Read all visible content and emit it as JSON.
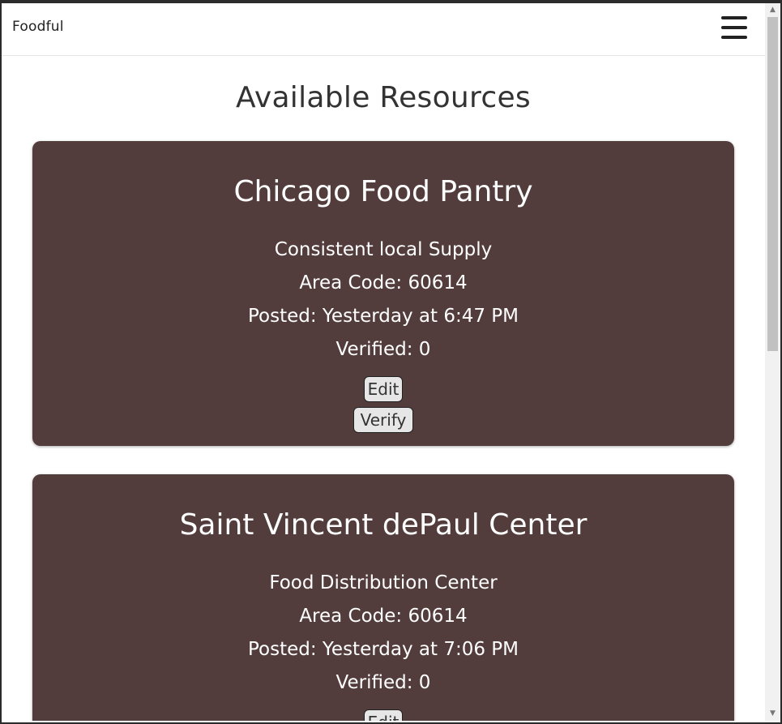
{
  "navbar": {
    "brand": "Foodful",
    "menu_icon": "hamburger-menu-icon"
  },
  "page": {
    "title": "Available Resources"
  },
  "resources": [
    {
      "name": "Chicago Food Pantry",
      "description": "Consistent local Supply",
      "area_code": "Area Code: 60614",
      "posted": "Posted: Yesterday at 6:47 PM",
      "verified": "Verified: 0",
      "edit_label": "Edit",
      "verify_label": "Verify"
    },
    {
      "name": "Saint Vincent dePaul Center",
      "description": "Food Distribution Center",
      "area_code": "Area Code: 60614",
      "posted": "Posted: Yesterday at 7:06 PM",
      "verified": "Verified: 0",
      "edit_label": "Edit"
    }
  ],
  "colors": {
    "card_background": "#533d3c",
    "card_text": "#ffffff",
    "button_background": "#e6e6e6"
  }
}
